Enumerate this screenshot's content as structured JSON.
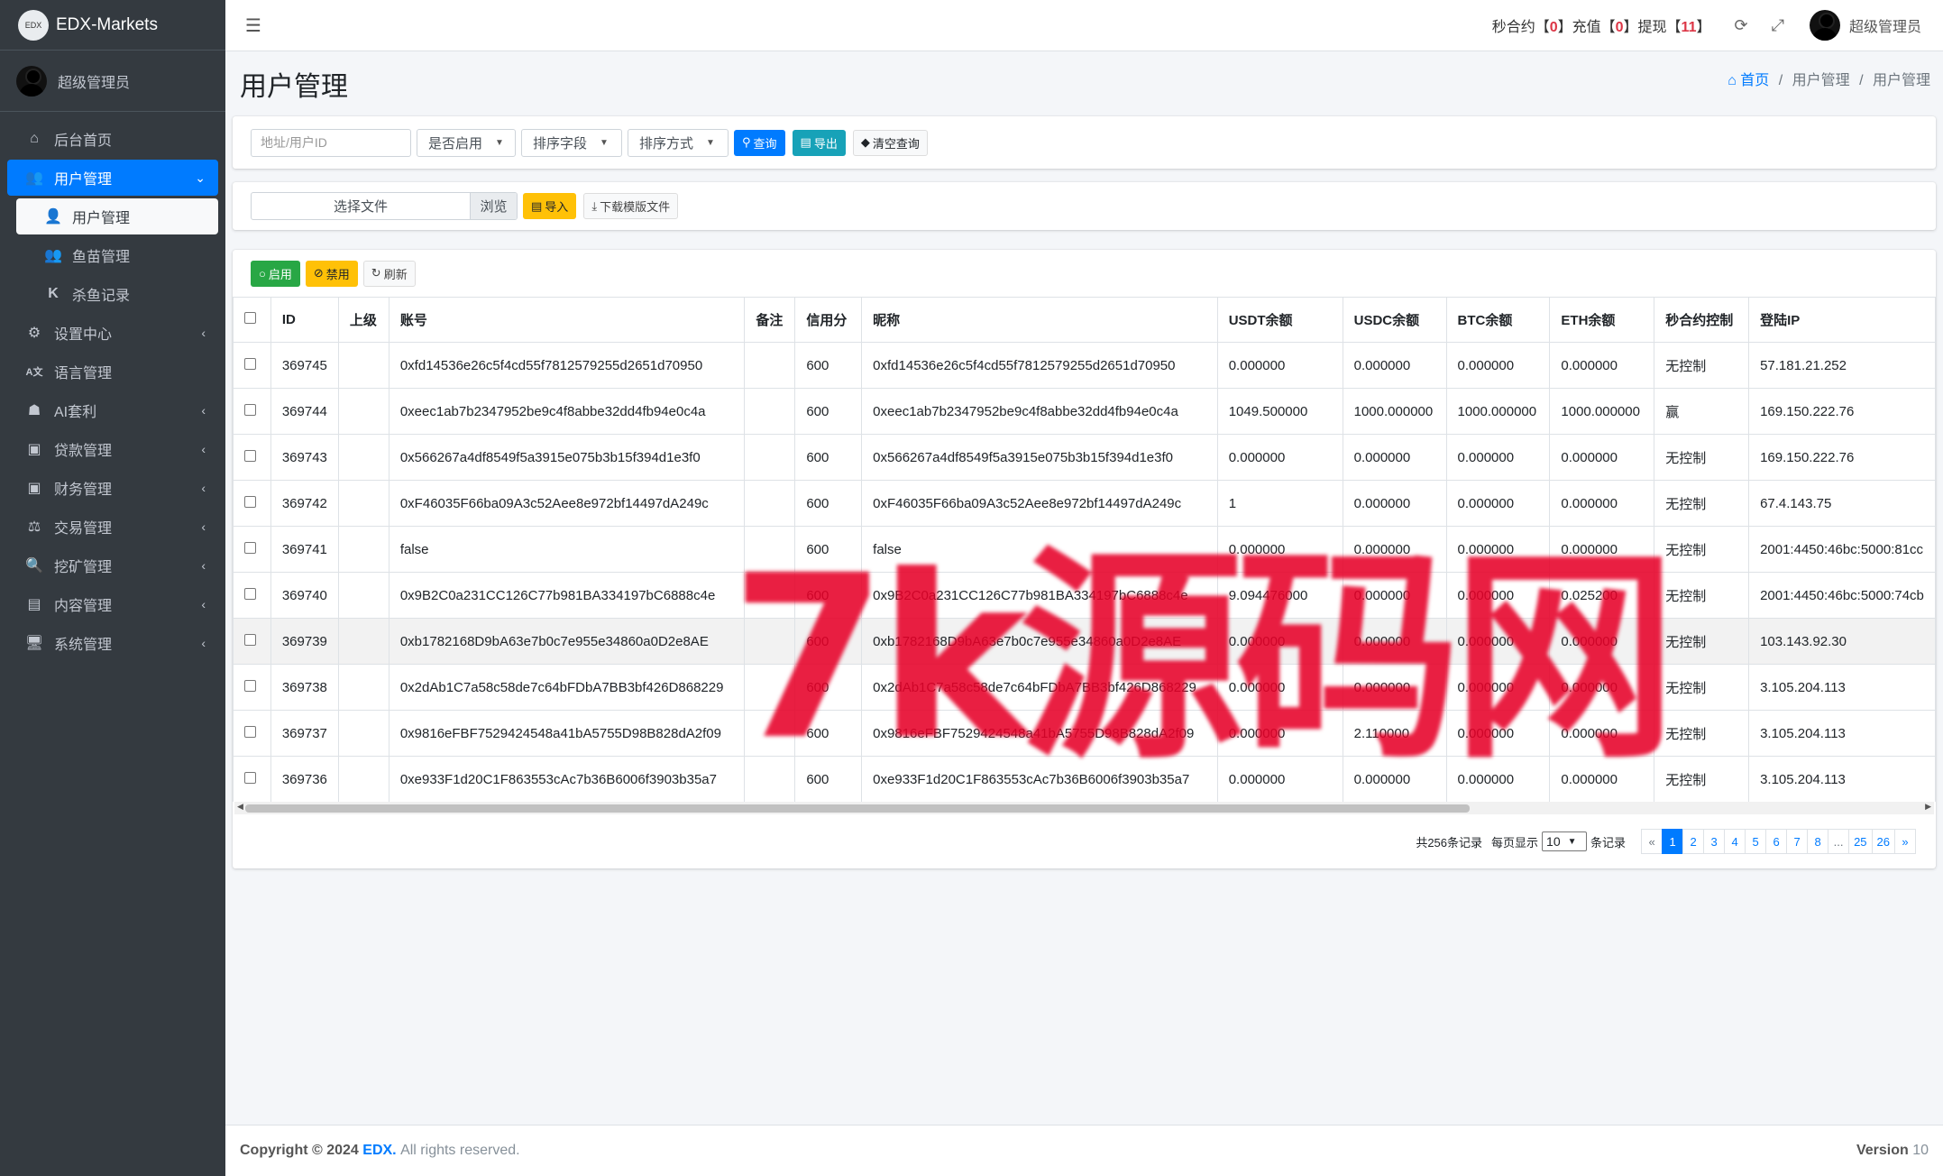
{
  "brand": {
    "logo_text": "EDX",
    "name": "EDX-Markets"
  },
  "sidebar": {
    "user_name": "超级管理员",
    "items": [
      {
        "label": "后台首页",
        "icon": "home-icon"
      },
      {
        "label": "用户管理",
        "icon": "users-icon"
      },
      {
        "label": "用户管理",
        "icon": "user-icon"
      },
      {
        "label": "鱼苗管理",
        "icon": "users-icon"
      },
      {
        "label": "杀鱼记录",
        "icon": "k-icon"
      },
      {
        "label": "设置中心",
        "icon": "cogs-icon"
      },
      {
        "label": "语言管理",
        "icon": "language-icon"
      },
      {
        "label": "AI套利",
        "icon": "robot-icon"
      },
      {
        "label": "贷款管理",
        "icon": "money-icon"
      },
      {
        "label": "财务管理",
        "icon": "money-icon"
      },
      {
        "label": "交易管理",
        "icon": "exchange-icon"
      },
      {
        "label": "挖矿管理",
        "icon": "search-icon"
      },
      {
        "label": "内容管理",
        "icon": "content-icon"
      },
      {
        "label": "系统管理",
        "icon": "desktop-icon"
      }
    ]
  },
  "topbar": {
    "stat_prefix": "秒合约【",
    "stat1": "0",
    "stat_mid1": "】充值【",
    "stat2": "0",
    "stat_mid2": "】提现【",
    "stat3": "11",
    "stat_suffix": "】",
    "admin": "超级管理员"
  },
  "page": {
    "title": "用户管理",
    "breadcrumb": {
      "home": "首页",
      "sep": "/",
      "level1": "用户管理",
      "level2": "用户管理"
    }
  },
  "filter": {
    "search_placeholder": "地址/用户ID",
    "enabled_select": "是否启用",
    "sort_field_select": "排序字段",
    "sort_order_select": "排序方式",
    "query_label": "查询",
    "export_label": "导出",
    "clear_label": "清空查询"
  },
  "import": {
    "file_label": "选择文件",
    "browse_label": "浏览",
    "import_label": "导入",
    "download_label": "下载模版文件"
  },
  "actions": {
    "enable_label": "启用",
    "disable_label": "禁用",
    "refresh_label": "刷新"
  },
  "table": {
    "headers": [
      "ID",
      "上级",
      "账号",
      "备注",
      "信用分",
      "昵称",
      "USDT余额",
      "USDC余额",
      "BTC余额",
      "ETH余额",
      "秒合约控制",
      "登陆IP"
    ],
    "rows": [
      [
        "369745",
        "",
        "0xfd14536e26c5f4cd55f7812579255d2651d70950",
        "",
        "600",
        "0xfd14536e26c5f4cd55f7812579255d2651d70950",
        "0.000000",
        "0.000000",
        "0.000000",
        "0.000000",
        "无控制",
        "57.181.21.252"
      ],
      [
        "369744",
        "",
        "0xeec1ab7b2347952be9c4f8abbe32dd4fb94e0c4a",
        "",
        "600",
        "0xeec1ab7b2347952be9c4f8abbe32dd4fb94e0c4a",
        "1049.500000",
        "1000.000000",
        "1000.000000",
        "1000.000000",
        "赢",
        "169.150.222.76"
      ],
      [
        "369743",
        "",
        "0x566267a4df8549f5a3915e075b3b15f394d1e3f0",
        "",
        "600",
        "0x566267a4df8549f5a3915e075b3b15f394d1e3f0",
        "0.000000",
        "0.000000",
        "0.000000",
        "0.000000",
        "无控制",
        "169.150.222.76"
      ],
      [
        "369742",
        "",
        "0xF46035F66ba09A3c52Aee8e972bf14497dA249c",
        "",
        "600",
        "0xF46035F66ba09A3c52Aee8e972bf14497dA249c",
        "1",
        "0.000000",
        "0.000000",
        "0.000000",
        "无控制",
        "67.4.143.75"
      ],
      [
        "369741",
        "",
        "false",
        "",
        "600",
        "false",
        "0.000000",
        "0.000000",
        "0.000000",
        "0.000000",
        "无控制",
        "2001:4450:46bc:5000:81cc"
      ],
      [
        "369740",
        "",
        "0x9B2C0a231CC126C77b981BA334197bC6888c4e",
        "",
        "600",
        "0x9B2C0a231CC126C77b981BA334197bC6888c4e",
        "9.094476000",
        "0.000000",
        "0.000000",
        "0.025200",
        "无控制",
        "2001:4450:46bc:5000:74cb"
      ],
      [
        "369739",
        "",
        "0xb1782168D9bA63e7b0c7e955e34860a0D2e8AE",
        "",
        "600",
        "0xb1782168D9bA63e7b0c7e955e34860a0D2e8AE",
        "0.000000",
        "0.000000",
        "0.000000",
        "0.000000",
        "无控制",
        "103.143.92.30"
      ],
      [
        "369738",
        "",
        "0x2dAb1C7a58c58de7c64bFDbA7BB3bf426D868229",
        "",
        "600",
        "0x2dAb1C7a58c58de7c64bFDbA7BB3bf426D868229",
        "0.000000",
        "0.000000",
        "0.000000",
        "0.000000",
        "无控制",
        "3.105.204.113"
      ],
      [
        "369737",
        "",
        "0x9816eFBF7529424548a41bA5755D98B828dA2f09",
        "",
        "600",
        "0x9816eFBF7529424548a41bA5755D98B828dA2f09",
        "0.000000",
        "2.110000",
        "0.000000",
        "0.000000",
        "无控制",
        "3.105.204.113"
      ],
      [
        "369736",
        "",
        "0xe933F1d20C1F863553cAc7b36B6006f3903b35a7",
        "",
        "600",
        "0xe933F1d20C1F863553cAc7b36B6006f3903b35a7",
        "0.000000",
        "0.000000",
        "0.000000",
        "0.000000",
        "无控制",
        "3.105.204.113"
      ]
    ]
  },
  "pagination": {
    "total_text": "共256条记录",
    "per_page_prefix": "每页显示",
    "per_page": "10",
    "per_page_suffix": "条记录",
    "pages": [
      "«",
      "1",
      "2",
      "3",
      "4",
      "5",
      "6",
      "7",
      "8",
      "...",
      "25",
      "26",
      "»"
    ],
    "active": "1"
  },
  "footer": {
    "copyright": "Copyright © 2024",
    "brand": "EDX.",
    "rights": "All rights reserved.",
    "version_label": "Version",
    "version": "10"
  },
  "watermark": "7k源码网",
  "colors": {
    "primary": "#007bff",
    "sidebar": "#343a40",
    "success": "#28a745",
    "warning": "#ffc107",
    "info": "#17a2b8",
    "watermark": "#e60028"
  }
}
